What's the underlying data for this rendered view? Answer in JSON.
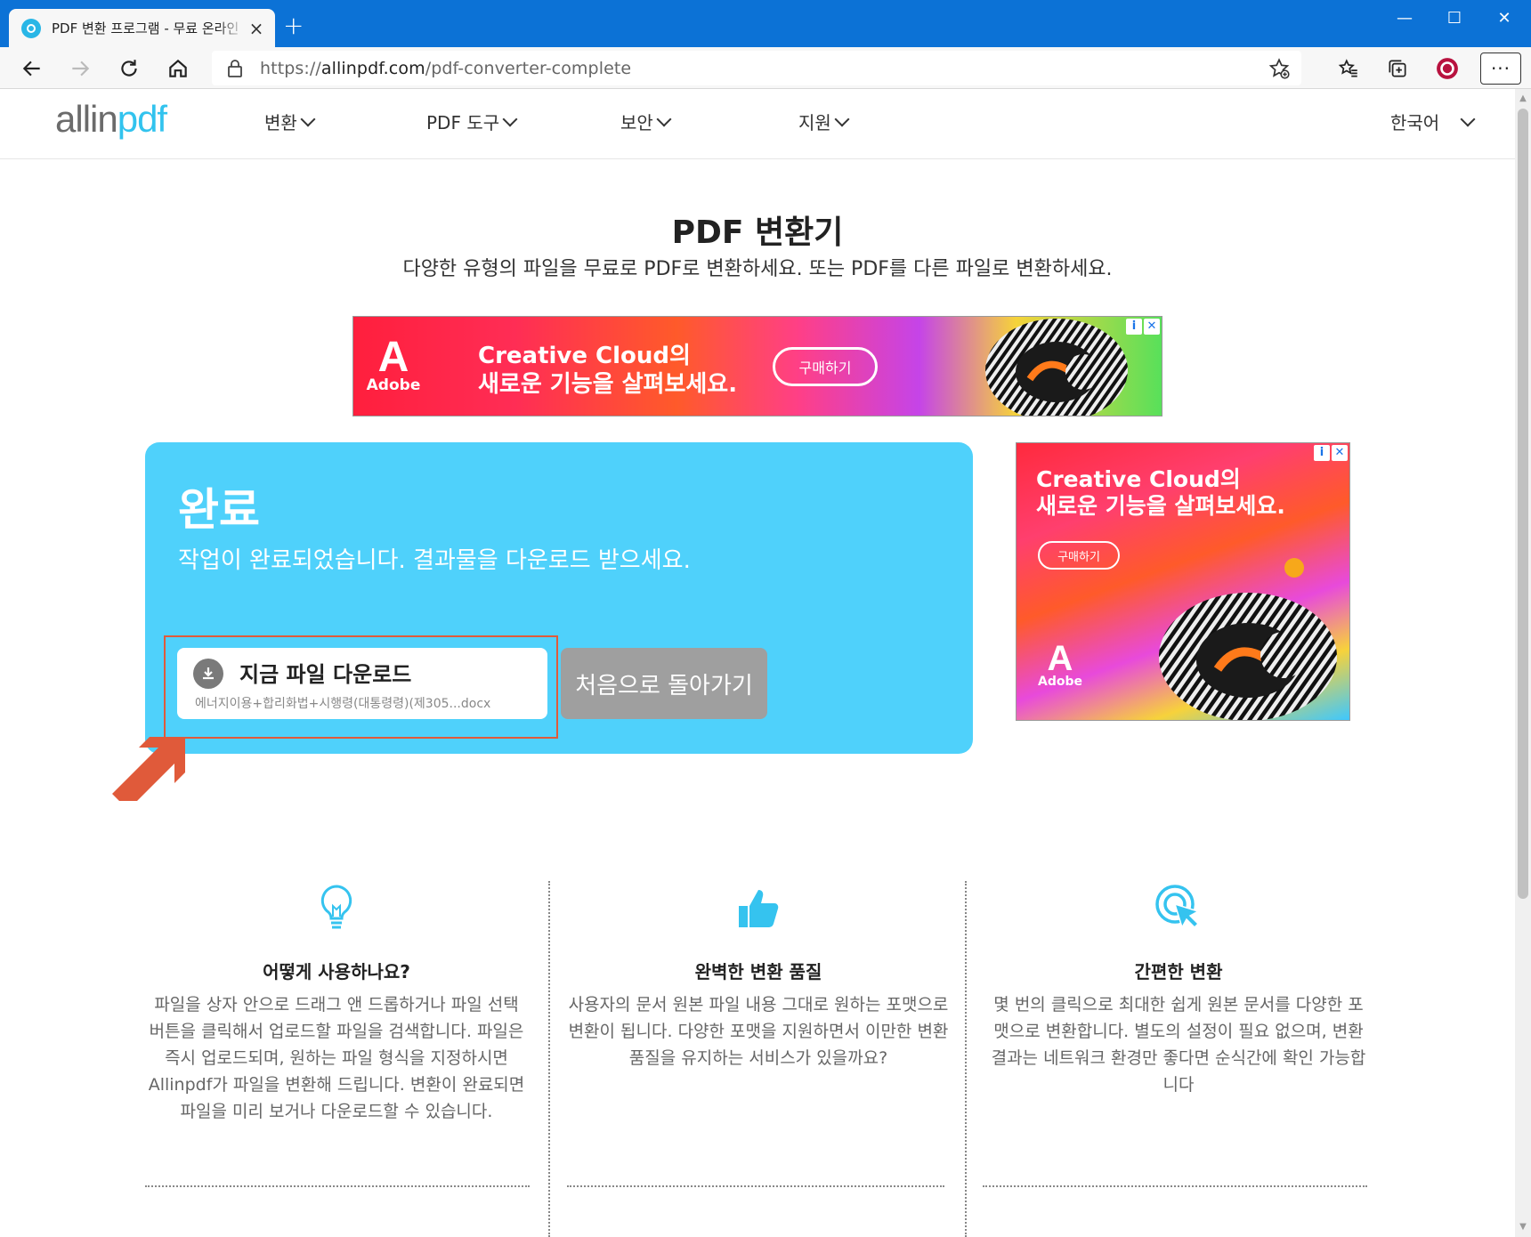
{
  "browser": {
    "tab_title": "PDF 변환 프로그램 - 무료 온라인",
    "tab_close": "×",
    "new_tab": "+",
    "minimize": "—",
    "maximize": "☐",
    "close": "✕",
    "url_scheme": "https://",
    "url_host": "allinpdf.com",
    "url_path": "/pdf-converter-complete",
    "more": "···"
  },
  "site": {
    "logo_a": "allin",
    "logo_b": "pdf",
    "nav": [
      "변환",
      "PDF 도구",
      "보안",
      "지원"
    ],
    "language": "한국어"
  },
  "hero": {
    "title": "PDF 변환기",
    "subtitle": "다양한 유형의 파일을 무료로 PDF로 변환하세요. 또는 PDF를 다른 파일로 변환하세요."
  },
  "ad": {
    "brand": "Adobe",
    "headline_1": "Creative Cloud의",
    "headline_2": "새로운 기능을 살펴보세요.",
    "cta": "구매하기",
    "info": "i",
    "close": "✕",
    "accent": "#ff2d55"
  },
  "complete": {
    "title": "완료",
    "subtitle": "작업이 완료되었습니다. 결과물을 다운로드 받으세요.",
    "download_label": "지금 파일 다운로드",
    "file_name": "에너지이용+합리화법+시행령(대통령령)(제305...docx",
    "back_label": "처음으로 돌아가기",
    "card_color": "#4fd1fb",
    "highlight_color": "#e05a3a"
  },
  "features": [
    {
      "icon": "lightbulb-icon",
      "title": "어떻게 사용하나요?",
      "body": "파일을 상자 안으로 드래그 앤 드롭하거나 파일 선택 버튼을 클릭해서 업로드할 파일을 검색합니다. 파일은 즉시 업로드되며, 원하는 파일 형식을 지정하시면 Allinpdf가 파일을 변환해 드립니다. 변환이 완료되면 파일을 미리 보거나 다운로드할 수 있습니다."
    },
    {
      "icon": "thumbs-up-icon",
      "title": "완벽한 변환 품질",
      "body": "사용자의 문서 원본 파일 내용 그대로 원하는 포맷으로 변환이 됩니다. 다양한 포맷을 지원하면서 이만한 변환 품질을 유지하는 서비스가 있을까요?"
    },
    {
      "icon": "click-cursor-icon",
      "title": "간편한 변환",
      "body": "몇 번의 클릭으로 최대한 쉽게 원본 문서를 다양한 포맷으로 변환합니다. 별도의 설정이 필요 없으며, 변환 결과는 네트워크 환경만 좋다면 순식간에 확인 가능합니다"
    }
  ]
}
